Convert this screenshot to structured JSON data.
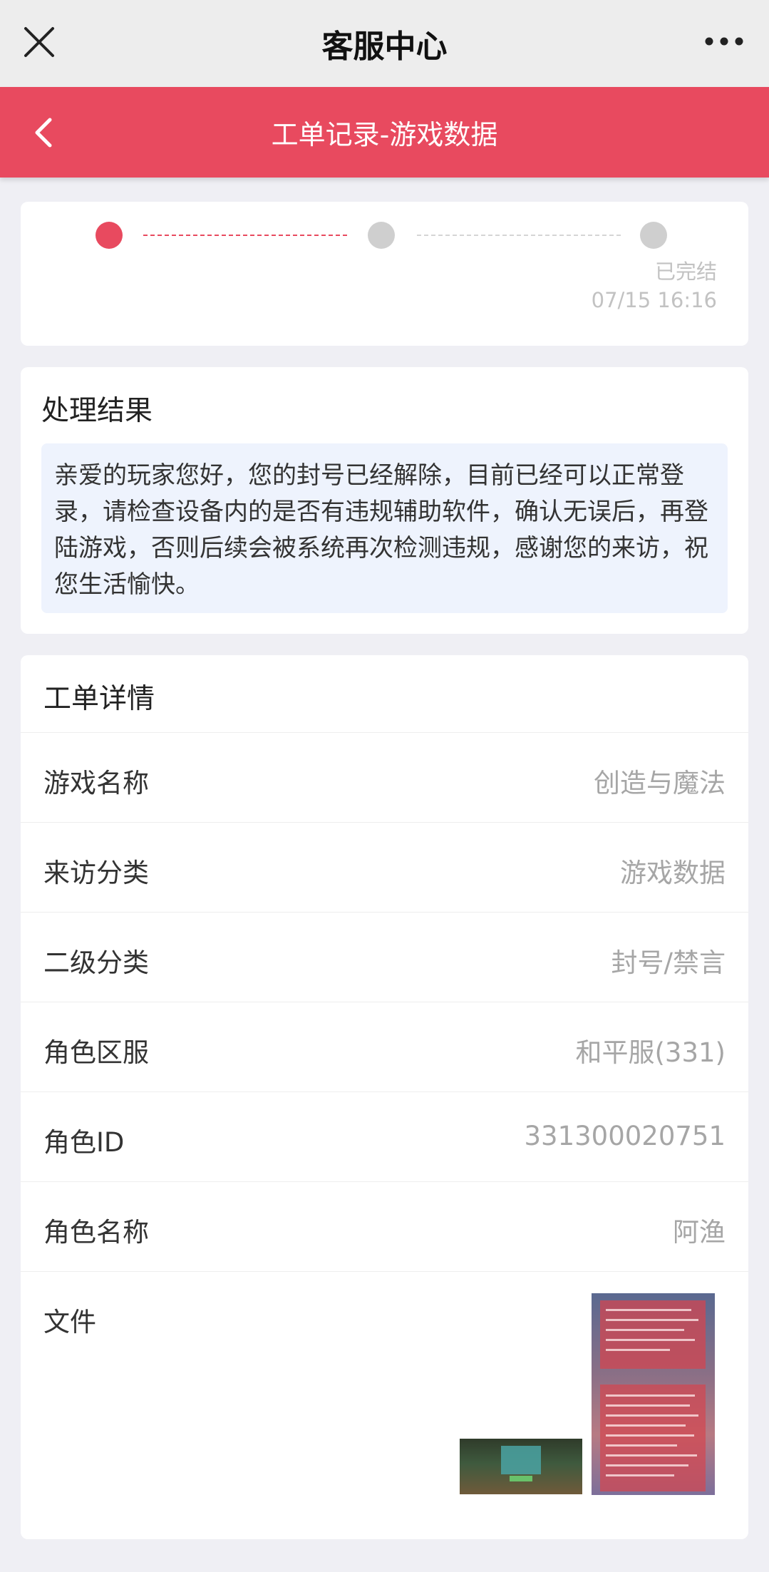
{
  "topbar": {
    "title": "客服中心",
    "close_icon": "close-icon",
    "more_icon": "more-dots-icon"
  },
  "header": {
    "title": "工单记录-游戏数据",
    "back_icon": "chevron-left-icon",
    "accent_color": "#e84a5f"
  },
  "progress": {
    "steps": [
      {
        "state": "active"
      },
      {
        "state": "pending"
      },
      {
        "state": "pending"
      }
    ],
    "final_status": "已完结",
    "final_time": "07/15 16:16"
  },
  "result": {
    "heading": "处理结果",
    "message": "亲爱的玩家您好，您的封号已经解除，目前已经可以正常登录，请检查设备内的是否有违规辅助软件，确认无误后，再登陆游戏，否则后续会被系统再次检测违规，感谢您的来访，祝您生活愉快。"
  },
  "detail": {
    "heading": "工单详情",
    "rows": [
      {
        "label": "游戏名称",
        "value": "创造与魔法"
      },
      {
        "label": "来访分类",
        "value": "游戏数据"
      },
      {
        "label": "二级分类",
        "value": "封号/禁言"
      },
      {
        "label": "角色区服",
        "value": "和平服(331)"
      },
      {
        "label": "角色ID",
        "value": "331300020751"
      },
      {
        "label": "角色名称",
        "value": "阿渔"
      }
    ],
    "file_label": "文件"
  }
}
